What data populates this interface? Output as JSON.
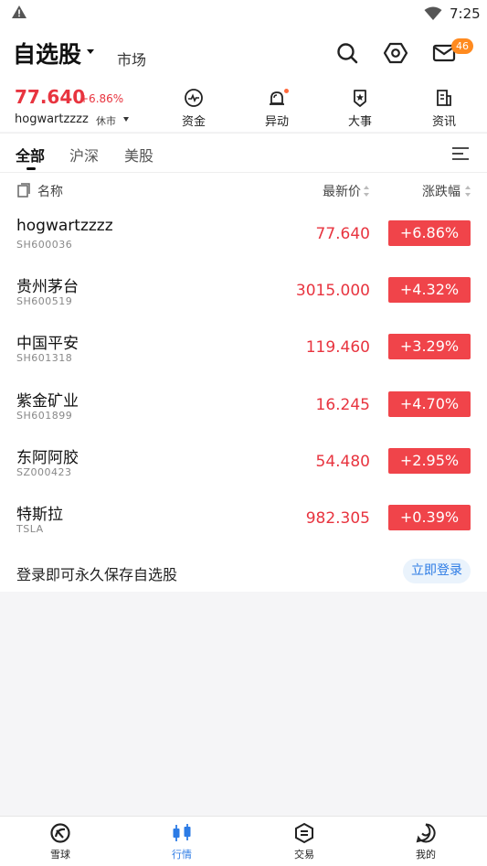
{
  "status_bar": {
    "time": "7:25",
    "warning_icon": "warning-triangle-icon",
    "wifi_icon": "wifi-icon"
  },
  "header": {
    "title": "自选股",
    "market_tab": "市场",
    "mail_badge": "46"
  },
  "quote": {
    "price": "77.640",
    "change": "+6.86%",
    "name": "hogwartzzzz",
    "status": "休市"
  },
  "quick_entries": [
    {
      "label": "资金",
      "icon": "fund-flow-icon"
    },
    {
      "label": "异动",
      "icon": "alert-bell-icon"
    },
    {
      "label": "大事",
      "icon": "event-badge-icon"
    },
    {
      "label": "资讯",
      "icon": "news-doc-icon"
    }
  ],
  "group_tabs": [
    {
      "label": "全部",
      "active": true
    },
    {
      "label": "沪深",
      "active": false
    },
    {
      "label": "美股",
      "active": false
    }
  ],
  "list_header": {
    "name": "名称",
    "price": "最新价",
    "change": "涨跌幅"
  },
  "stocks": [
    {
      "name": "hogwartzzzz",
      "code": "SH600036",
      "price": "77.640",
      "change": "+6.86%"
    },
    {
      "name": "贵州茅台",
      "code": "SH600519",
      "price": "3015.000",
      "change": "+4.32%"
    },
    {
      "name": "中国平安",
      "code": "SH601318",
      "price": "119.460",
      "change": "+3.29%"
    },
    {
      "name": "紫金矿业",
      "code": "SH601899",
      "price": "16.245",
      "change": "+4.70%"
    },
    {
      "name": "东阿阿胶",
      "code": "SZ000423",
      "price": "54.480",
      "change": "+2.95%"
    },
    {
      "name": "特斯拉",
      "code": "TSLA",
      "price": "982.305",
      "change": "+0.39%"
    }
  ],
  "login_prompt": {
    "text": "登录即可永久保存自选股",
    "button": "立即登录"
  },
  "bottom_nav": [
    {
      "label": "雪球",
      "icon": "snowball-icon",
      "active": false
    },
    {
      "label": "行情",
      "icon": "candlestick-icon",
      "active": true
    },
    {
      "label": "交易",
      "icon": "trade-icon",
      "active": false
    },
    {
      "label": "我的",
      "icon": "profile-icon",
      "active": false
    }
  ],
  "colors": {
    "up_red": "#e8343f",
    "up_red_badge": "#f0444a",
    "accent_blue": "#2c7be5",
    "badge_orange": "#ff8a1f"
  }
}
